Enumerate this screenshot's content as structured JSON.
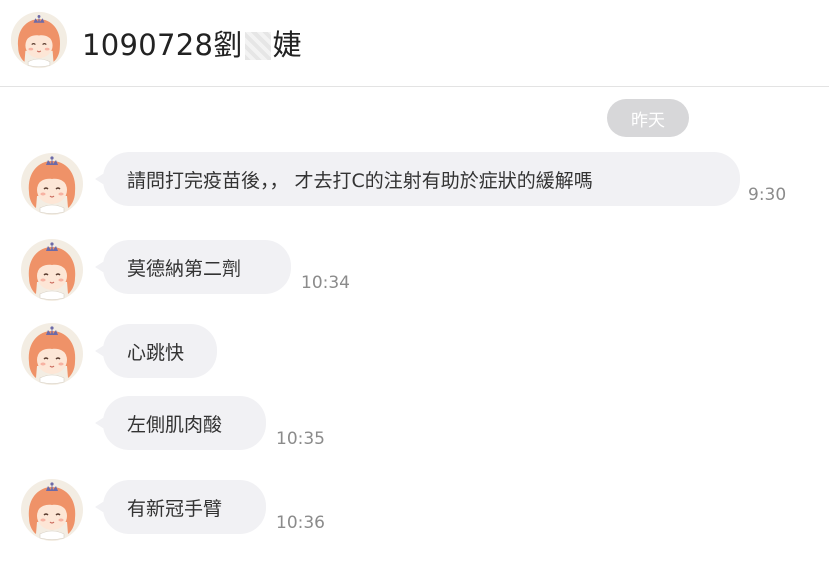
{
  "header": {
    "title_prefix": "1090728劉",
    "title_suffix": "婕"
  },
  "divider": {
    "label": "昨天"
  },
  "messages": [
    {
      "text": "請問打完疫苗後，，   才去打C的注射有助於症狀的緩解嗎",
      "time": "9:30"
    },
    {
      "text": "莫德納第二劑",
      "time": "10:34"
    },
    {
      "text": "心跳快",
      "time": ""
    },
    {
      "text": "左側肌肉酸",
      "time": "10:35"
    },
    {
      "text": "有新冠手臂",
      "time": "10:36"
    }
  ],
  "colors": {
    "bubble_bg": "#f1f1f4",
    "divider_bg": "#d7d7d9",
    "time_text": "#8b8b8b"
  },
  "icons": {
    "avatar": "girl-with-crown-avatar-icon"
  }
}
